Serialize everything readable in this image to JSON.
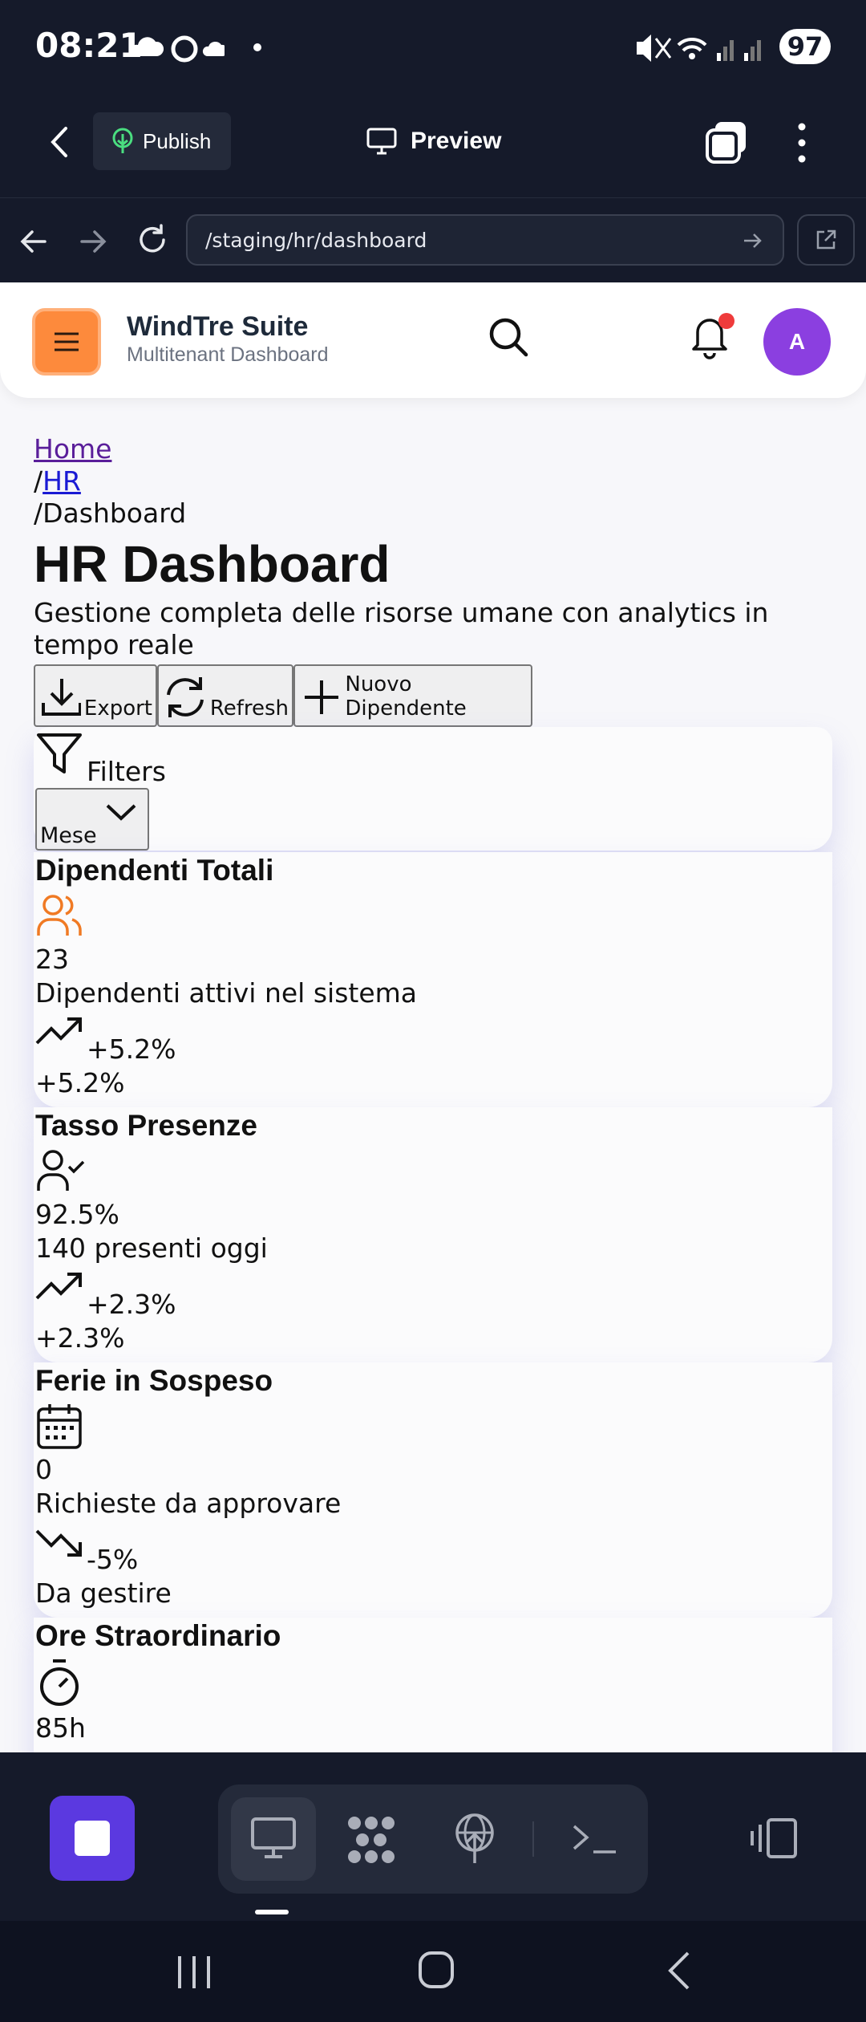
{
  "status_bar": {
    "time": "08:21",
    "battery": "97"
  },
  "toolbar": {
    "publish_label": "Publish",
    "preview_label": "Preview"
  },
  "browser": {
    "url": "/staging/hr/dashboard"
  },
  "app_header": {
    "title": "WindTre Suite",
    "subtitle": "Multitenant Dashboard",
    "avatar_initial": "A"
  },
  "breadcrumb": {
    "home": "Home",
    "hr": "HR",
    "current": "/Dashboard",
    "separator": "/"
  },
  "page": {
    "title": "HR Dashboard",
    "description": "Gestione completa delle risorse umane con analytics in tempo reale"
  },
  "actions": {
    "export": "Export",
    "refresh": "Refresh",
    "new_employee": "Nuovo Dipendente"
  },
  "filters": {
    "label": "Filters",
    "period_value": "Mese"
  },
  "cards": [
    {
      "title": "Dipendenti Totali",
      "value": "23",
      "description": "Dipendenti attivi nel sistema",
      "trend": "+5.2%",
      "footer": "+5.2%"
    },
    {
      "title": "Tasso Presenze",
      "value": "92.5%",
      "description": "140 presenti oggi",
      "trend": "+2.3%",
      "footer": "+2.3%"
    },
    {
      "title": "Ferie in Sospeso",
      "value": "0",
      "description": "Richieste da approvare",
      "trend": "-5%",
      "footer": "Da gestire"
    },
    {
      "title": "Ore Straordinario",
      "value": "85h"
    }
  ],
  "colors": {
    "accent_orange": "#fd8a3c",
    "avatar_purple": "#8b3fe0",
    "stop_button": "#5b39e0",
    "notification": "#ef3b3b"
  }
}
